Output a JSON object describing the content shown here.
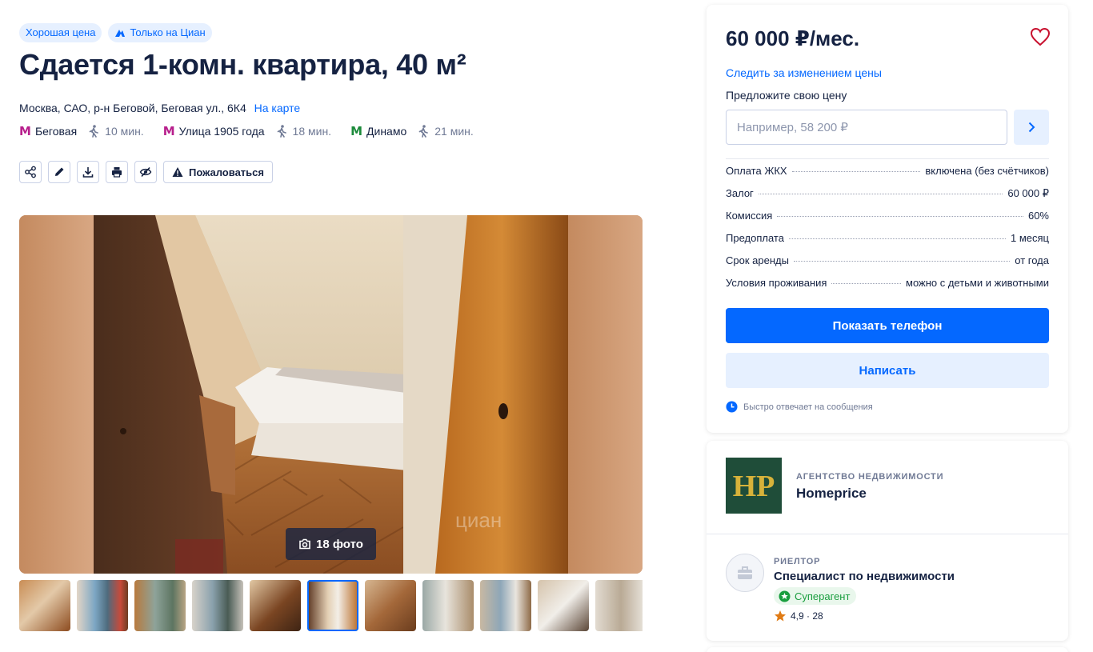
{
  "badges": [
    "Хорошая цена",
    "Только на Циан"
  ],
  "title": "Сдается 1-комн. квартира, 40 м²",
  "address": {
    "text": "Москва, САО, р-н Беговой, Беговая ул., 6К4",
    "map_link": "На карте"
  },
  "metro": [
    {
      "name": "Беговая",
      "time": "10 мин.",
      "color": "#b71f8c"
    },
    {
      "name": "Улица 1905 года",
      "time": "18 мин.",
      "color": "#b71f8c"
    },
    {
      "name": "Динамо",
      "time": "21 мин.",
      "color": "#1b8a3a"
    }
  ],
  "metro_letter": "М",
  "toolbar": {
    "icons": [
      "share-icon",
      "edit-icon",
      "download-icon",
      "print-icon",
      "hide-icon"
    ],
    "complain_label": "Пожаловаться"
  },
  "gallery": {
    "photo_count": "18 фото",
    "watermark": "циан",
    "thumbnails": 11,
    "active_thumbnail": 6
  },
  "price_card": {
    "price": "60 000 ₽/мес.",
    "follow_price": "Следить за изменением цены",
    "offer_label": "Предложите свою цену",
    "offer_placeholder": "Например, 58 200 ₽",
    "terms": [
      {
        "key": "Оплата ЖКХ",
        "value": "включена (без счётчиков)"
      },
      {
        "key": "Залог",
        "value": "60 000 ₽"
      },
      {
        "key": "Комиссия",
        "value": "60%"
      },
      {
        "key": "Предоплата",
        "value": "1 месяц"
      },
      {
        "key": "Срок аренды",
        "value": "от года"
      },
      {
        "key": "Условия проживания",
        "value": "можно с детьми и животными"
      }
    ],
    "show_phone": "Показать телефон",
    "write": "Написать",
    "fast_reply": "Быстро отвечает на сообщения"
  },
  "agency": {
    "kind": "АГЕНТСТВО НЕДВИЖИМОСТИ",
    "name": "Homeprice",
    "logo_text": "HP"
  },
  "realtor": {
    "kind": "РИЕЛТОР",
    "name": "Специалист по недвижимости",
    "badge": "Суперагент",
    "rating": "4,9 · 28"
  },
  "colors": {
    "accent": "#0468ff",
    "accent_light": "#e6f0ff",
    "text": "#152242",
    "muted": "#707a95",
    "success": "#1a9e3f",
    "favorite": "#c8102e",
    "star": "#e07b15"
  }
}
